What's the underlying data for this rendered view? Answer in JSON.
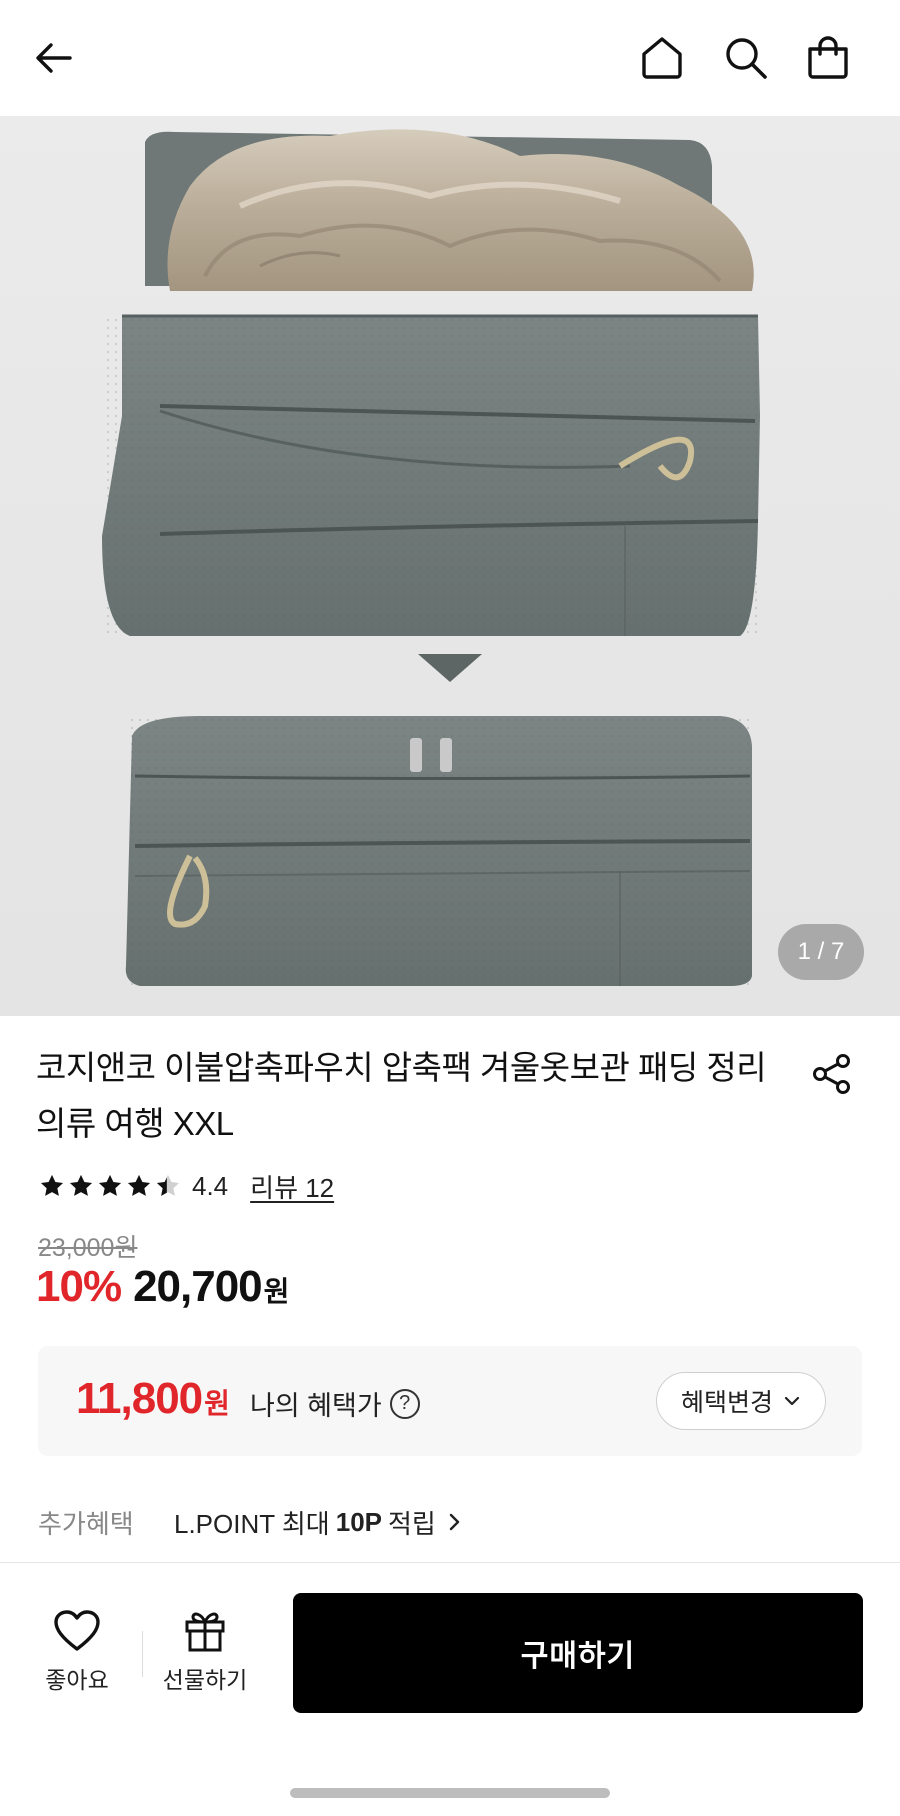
{
  "header": {
    "back_icon": "arrow-left-icon",
    "home_icon": "home-icon",
    "search_icon": "search-icon",
    "cart_icon": "shopping-bag-icon"
  },
  "gallery": {
    "counter": "1 / 7"
  },
  "product": {
    "title": "코지앤코 이불압축파우치 압축팩 겨울옷보관 패딩 정리 의류 여행 XXL",
    "share_icon": "share-icon",
    "rating": "4.4",
    "rating_value": 4.4,
    "review_link": "리뷰 12",
    "original_price": "23,000원",
    "discount": "10%",
    "sale_price": "20,700",
    "sale_unit": "원",
    "accent_color": "#e0262a"
  },
  "benefit": {
    "price": "11,800",
    "unit": "원",
    "label": "나의 혜택가",
    "help": "?",
    "change_button": "혜택변경"
  },
  "extra": {
    "label": "추가혜택",
    "text_prefix": "L.POINT 최대",
    "text_bold": "10P",
    "text_suffix": "적립"
  },
  "bottom_bar": {
    "like_label": "좋아요",
    "gift_label": "선물하기",
    "buy_label": "구매하기"
  }
}
